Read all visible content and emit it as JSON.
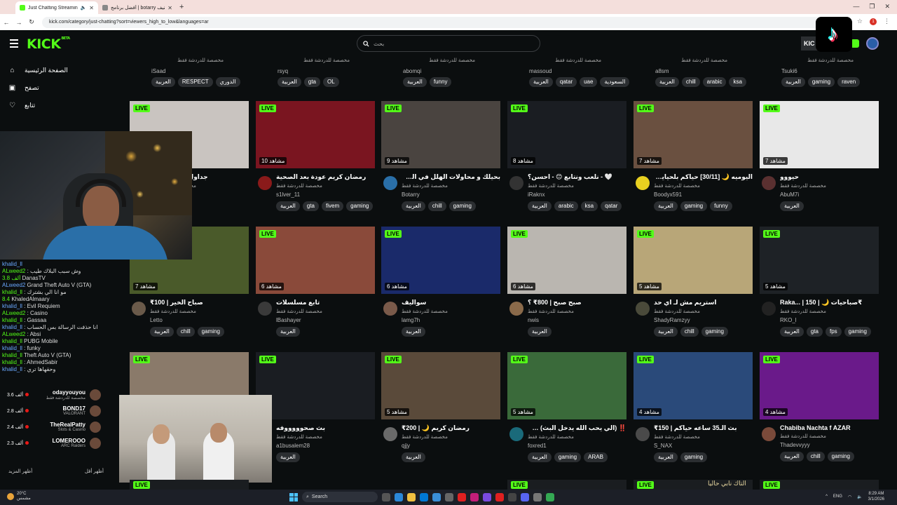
{
  "browser": {
    "tabs": [
      {
        "title": "Just Chatting Streaming - Li",
        "active": true
      },
      {
        "title": "أفضل برنامج | botarry تصنيف",
        "active": false
      }
    ],
    "url": "kick.com/category/just-chatting?sort=viewers_high_to_low&languages=ar"
  },
  "header": {
    "logo": "KICK",
    "logo_sup": "BETA",
    "search_placeholder": "بحث",
    "login_label": "KIC"
  },
  "sidebar": {
    "nav": [
      {
        "label": "الصفحة الرئيسية",
        "icon": "home-icon"
      },
      {
        "label": "تصفح",
        "icon": "browse-icon"
      },
      {
        "label": "تتابع",
        "icon": "heart-icon"
      }
    ],
    "chat": [
      {
        "user": "khalid_ll",
        "text": ""
      },
      {
        "user": "ALweed2",
        "text": ": وش سبب البلاك طيب"
      },
      {
        "user": "3.8 ألف",
        "text": "DanasTV"
      },
      {
        "user": "ALweed2",
        "text": "Grand Theft Auto V (GTA)"
      },
      {
        "user": "khalid_ll",
        "text": ": مو انا الي بشترك"
      },
      {
        "user": "8.4",
        "text": "KhaledAlmaary"
      },
      {
        "user": "khalid_ll",
        "text": ": Evil Requiem"
      },
      {
        "user": "ALweed2",
        "text": ": Casino"
      },
      {
        "user": "khalid_ll",
        "text": ": Gassaa"
      },
      {
        "user": "khalid_ll",
        "text": ": انا حذفت الرسالة بس الحساب"
      },
      {
        "user": "ALweed2",
        "text": ": Absi"
      },
      {
        "user": "khalid_ll",
        "text": "PUBG Mobile"
      },
      {
        "user": "khalid_ll",
        "text": ": funky"
      },
      {
        "user": "khalid_ll",
        "text": "Theft Auto V (GTA)"
      },
      {
        "user": "khalid_ll",
        "text": ": AhmedSabir"
      },
      {
        "user": "khalid_ll",
        "text": ": وحقهاها تري"
      }
    ],
    "recommended": [
      {
        "viewers": "3.6 ألف",
        "name": "odayyouyou",
        "category": "مخصصة للدردشة فقط"
      },
      {
        "viewers": "2.8 ألف",
        "name": "BOND17",
        "category": "VALORANT"
      },
      {
        "viewers": "2.4 ألف",
        "name": "TheRealPatty",
        "category": "Slots & Casino"
      },
      {
        "viewers": "2.3 ألف",
        "name": "LOMEROOO",
        "category": "ARC Raiders"
      }
    ],
    "show_more": "أظهر المزيد",
    "show_less": "أظهر أقل"
  },
  "top_row": [
    {
      "category": "مخصصة للدردشة فقط",
      "name": "iSaad",
      "tags": [
        "العربية",
        "RESPECT",
        "الدوري"
      ]
    },
    {
      "category": "مخصصة للدردشة فقط",
      "name": "rsyq",
      "tags": [
        "العربية",
        "gta",
        "OL"
      ]
    },
    {
      "category": "مخصصة للدردشة فقط",
      "name": "abomqi",
      "tags": [
        "العربية",
        "funny"
      ]
    },
    {
      "category": "مخصصة للدردشة فقط",
      "name": "massoud",
      "tags": [
        "العربية",
        "qatar",
        "uae",
        "السعودية"
      ]
    },
    {
      "category": "مخصصة للدردشة فقط",
      "name": "a8sm",
      "tags": [
        "العربية",
        "chill",
        "arabic",
        "ksa"
      ]
    },
    {
      "category": "مخصصة للدردشة فقط",
      "name": "Tsuki6",
      "tags": [
        "العربية",
        "gaming",
        "raven"
      ]
    }
  ],
  "cards": [
    {
      "live": "LIVE",
      "viewers": "",
      "title": "جداول رمضان 🤍 #",
      "category": "مخصصة للدردشة فقط",
      "name": "",
      "tags": [
        "gaming"
      ],
      "bg": "#c9c4c0",
      "av": "#444"
    },
    {
      "live": "LIVE",
      "viewers": "10 مشاهد",
      "title": "رمضان كريم عودة بعد الصحية",
      "category": "مخصصة للدردشة فقط",
      "name": "s1lver_11",
      "tags": [
        "العربية",
        "gta",
        "fivem",
        "gaming"
      ],
      "bg": "#7a1520",
      "av": "#8a1a1a"
    },
    {
      "live": "LIVE",
      "viewers": "9 مشاهد",
      "title": "بحيلك و محاولات الهلل في الجحيم...",
      "category": "مخصصة للدردشة فقط",
      "name": "Botarry",
      "tags": [
        "العربية",
        "chill",
        "gaming"
      ],
      "bg": "#4a4440",
      "av": "#2a6fa8"
    },
    {
      "live": "LIVE",
      "viewers": "8 مشاهد",
      "title": "🤍 - نلعب ونتابع 😊 - احسن؟",
      "category": "مخصصة للدردشة فقط",
      "name": "iRaknx",
      "tags": [
        "العربية",
        "arabic",
        "ksa",
        "qatar"
      ],
      "bg": "#1a1d22",
      "av": "#333"
    },
    {
      "live": "LIVE",
      "viewers": "7 مشاهد",
      "title": "اليوميه 🌙 [30/11] حياكم بلحيايب...",
      "category": "مخصصة للدردشة فقط",
      "name": "Boodyx591",
      "tags": [
        "العربية",
        "gaming",
        "funny"
      ],
      "bg": "#6a5040",
      "av": "#e8d020"
    },
    {
      "live": "LIVE",
      "viewers": "7 مشاهد",
      "title": "حيووو",
      "category": "مخصصة للدردشة فقط",
      "name": "AbuM7i",
      "tags": [
        "العربية"
      ],
      "bg": "#e8e8e8",
      "av": "#5a3030"
    },
    {
      "live": "LIVE",
      "viewers": "7 مشاهد",
      "title": "صباح الخير | 100₹",
      "category": "مخصصة للدردشة فقط",
      "name": "Letto",
      "tags": [
        "العربية",
        "chill",
        "gaming"
      ],
      "bg": "#4a5a2a",
      "av": "#6a5a4a"
    },
    {
      "live": "LIVE",
      "viewers": "6 مشاهد",
      "title": "تابع مسلسلات",
      "category": "مخصصة للدردشة فقط",
      "name": "lBashayer",
      "tags": [
        "العربية"
      ],
      "bg": "#8a4a3a",
      "av": "#3a3a3a"
    },
    {
      "live": "LIVE",
      "viewers": "6 مشاهد",
      "title": "سواليف",
      "category": "مخصصة للدردشة فقط",
      "name": "lamg7h",
      "tags": [
        "العربية"
      ],
      "bg": "#1a2a6a",
      "av": "#7a5a4a"
    },
    {
      "live": "LIVE",
      "viewers": "6 مشاهد",
      "title": "صبح صبح | 800₹ ؟",
      "category": "مخصصة للدردشة فقط",
      "name": "nwis",
      "tags": [
        "العربية"
      ],
      "bg": "#bab6b0",
      "av": "#8a6a4a"
    },
    {
      "live": "LIVE",
      "viewers": "5 مشاهد",
      "title": "استريم مش لـ اي حد",
      "category": "مخصصة للدردشة فقط",
      "name": "ShadyRamzyy",
      "tags": [
        "العربية",
        "chill",
        "gaming"
      ],
      "bg": "#b8a678",
      "av": "#4a4a3a"
    },
    {
      "live": "LIVE",
      "viewers": "5 مشاهد",
      "title": "Raka... | صباحيات 🌙 | 150₹",
      "category": "مخصصة للدردشة فقط",
      "name": "RKO_l",
      "tags": [
        "العربية",
        "gta",
        "fps",
        "gaming"
      ],
      "bg": "#1e2226",
      "av": "#222"
    },
    {
      "live": "LIVE",
      "viewers": "",
      "title": "",
      "category": "",
      "name": "",
      "tags": [],
      "bg": "#8a7a6a",
      "av": "#444"
    },
    {
      "live": "LIVE",
      "viewers": "",
      "title": "بث صحوووووفه",
      "category": "مخصصة للدردشة فقط",
      "name": "a1busalem28",
      "tags": [
        "العربية"
      ],
      "bg": "#1a1d22",
      "av": "#333"
    },
    {
      "live": "LIVE",
      "viewers": "5 مشاهد",
      "title": "رمضان كريم 🌙 | 200₹",
      "category": "مخصصة للدردشة فقط",
      "name": "qjjy",
      "tags": [
        "العربية"
      ],
      "bg": "#5a4a3a",
      "av": "#6a6a6a"
    },
    {
      "live": "LIVE",
      "viewers": "5 مشاهد",
      "title": "‼️ (الي يحب الله يدخل البث) ‼️ ريف...",
      "category": "مخصصة للدردشة فقط",
      "name": "foxred1",
      "tags": [
        "العربية",
        "gaming",
        "ARAB"
      ],
      "bg": "#3a6a3a",
      "av": "#1a6a7a"
    },
    {
      "live": "LIVE",
      "viewers": "4 مشاهد",
      "title": "بث الـ35 ساعه حياكم | 150₹",
      "category": "مخصصة للدردشة فقط",
      "name": "S_NAX",
      "tags": [
        "العربية",
        "gaming"
      ],
      "bg": "#2a4a7a",
      "av": "#4a4a4a"
    },
    {
      "live": "LIVE",
      "viewers": "4 مشاهد",
      "title": "Chabiba Nachta f AZAR",
      "category": "مخصصة للدردشة فقط",
      "name": "Thadevvyyy",
      "tags": [
        "العربية",
        "chill",
        "gaming"
      ],
      "bg": "#6a1a8a",
      "av": "#7a4a3a"
    }
  ],
  "bottom_partial": [
    "LIVE",
    "LIVE",
    "LIVE",
    "LIVE"
  ],
  "bottom_text": "التاك نابي حاليا",
  "taskbar": {
    "weather_temp": "20°C",
    "weather_desc": "مشمس",
    "search_label": "Search",
    "lang": "ENG",
    "time": "8:29 AM",
    "date": "3/1/2026"
  }
}
